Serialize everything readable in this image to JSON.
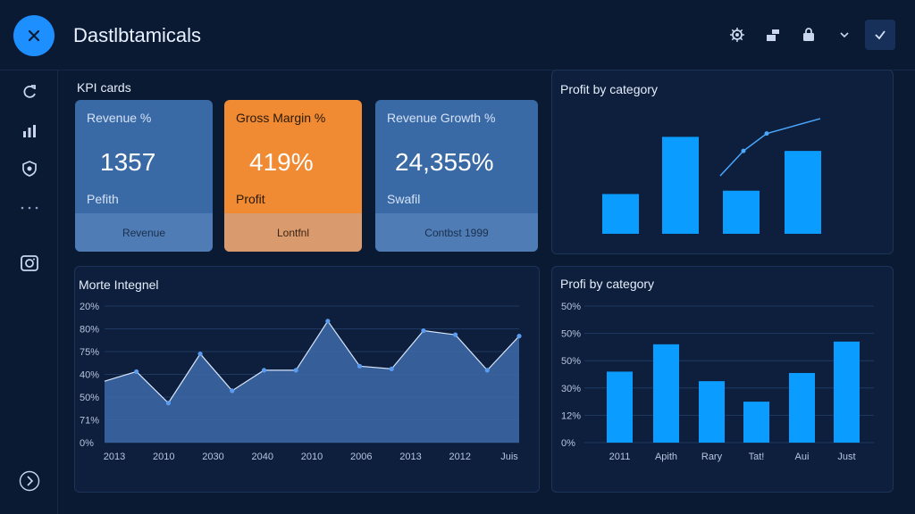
{
  "app": {
    "title": "Dastlbtamicals"
  },
  "icons": {
    "close": "close-icon",
    "settings": "gear-icon",
    "export": "export-icon",
    "lock": "lock-icon",
    "chevron": "chevron-down-icon",
    "confirm": "check-icon"
  },
  "sidebar": {
    "items": [
      "refresh-icon",
      "bar-chart-icon",
      "shield-icon",
      "more-icon",
      "camera-icon"
    ],
    "collapse_icon": "chevron-right-icon"
  },
  "kpi": {
    "section_title": "KPI cards",
    "cards": [
      {
        "label": "Revenue %",
        "value": "1357",
        "sub": "Pefith",
        "footer": "Revenue",
        "color": "#3a6aa6"
      },
      {
        "label": "Gross Margin %",
        "value": "419%",
        "sub": "Profit",
        "footer": "Lontfnl",
        "color": "#f08a33"
      },
      {
        "label": "Revenue Growth %",
        "value": "24,355%",
        "sub": "Swafil",
        "footer": "Contbst 1999",
        "color": "#3a6aa6"
      }
    ]
  },
  "panels": {
    "top_right_title": "Profit by category",
    "line_title": "Morte Integnel",
    "bottom_right_title": "Profi by category"
  },
  "chart_data": [
    {
      "type": "bar",
      "title": "Profit by category",
      "values": [
        48,
        117,
        52,
        100
      ],
      "overlay_line": [
        70,
        100,
        121,
        139
      ],
      "ylim": [
        0,
        140
      ],
      "grid": false,
      "color": "#0a9cff"
    },
    {
      "type": "area",
      "title": "Morte Integnel",
      "categories": [
        "2013",
        "2010",
        "2030",
        "2040",
        "2010",
        "2006",
        "2013",
        "2012",
        "Juis"
      ],
      "y_tick_labels": [
        "20%",
        "80%",
        "75%",
        "40%",
        "50%",
        "71%",
        "0%"
      ],
      "values": [
        45,
        52,
        29,
        65,
        38,
        53,
        53,
        89,
        56,
        54,
        82,
        79,
        53,
        78
      ],
      "ylim": [
        0,
        100
      ],
      "grid": true,
      "color": "#3e6aa8"
    },
    {
      "type": "bar",
      "title": "Profi by category",
      "categories": [
        "2011",
        "Apith",
        "Rary",
        "Tat!",
        "Aui",
        "Just"
      ],
      "y_tick_labels": [
        "50%",
        "50%",
        "50%",
        "30%",
        "12%",
        "0%"
      ],
      "values": [
        52,
        72,
        45,
        30,
        51,
        74
      ],
      "ylim": [
        0,
        100
      ],
      "grid": true,
      "color": "#0a9cff"
    }
  ]
}
